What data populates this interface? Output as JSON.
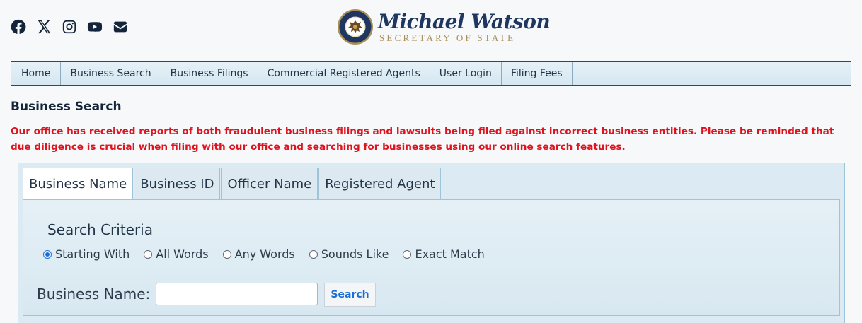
{
  "social": {
    "icons": [
      "facebook-icon",
      "x-twitter-icon",
      "instagram-icon",
      "youtube-icon",
      "envelope-icon"
    ]
  },
  "brand": {
    "name": "Michael Watson",
    "subtitle": "SECRETARY OF STATE",
    "seal_icon": "state-seal-icon"
  },
  "nav": {
    "items": [
      "Home",
      "Business Search",
      "Business Filings",
      "Commercial Registered Agents",
      "User Login",
      "Filing Fees"
    ]
  },
  "page": {
    "title": "Business Search",
    "warning": "Our office has received reports of both fraudulent business filings and lawsuits being filed against incorrect business entities. Please be reminded that due diligence is crucial when filing with our office and searching for businesses using our online search features."
  },
  "tabs": {
    "items": [
      "Business Name",
      "Business ID",
      "Officer Name",
      "Registered Agent"
    ],
    "active": "Business Name"
  },
  "search": {
    "criteria_title": "Search Criteria",
    "options": [
      "Starting With",
      "All Words",
      "Any Words",
      "Sounds Like",
      "Exact Match"
    ],
    "selected": "Starting With",
    "field_label": "Business Name:",
    "field_value": "",
    "button_label": "Search"
  },
  "colors": {
    "brand_blue": "#1f3760",
    "brand_gold": "#a9905a",
    "warning_red": "#e0121d",
    "link_blue": "#1a6fd6",
    "panel_bg": "#dcebf3"
  }
}
